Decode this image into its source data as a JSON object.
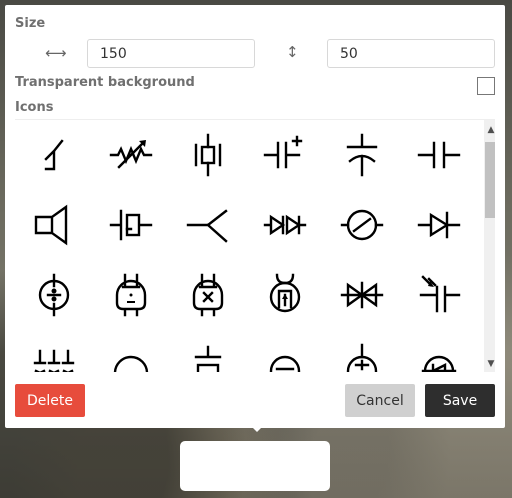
{
  "size": {
    "label": "Size",
    "width_icon": "horizontal-resize-icon",
    "width_value": "150",
    "height_icon": "vertical-resize-icon",
    "height_value": "50"
  },
  "transparent": {
    "label": "Transparent background",
    "checked": false
  },
  "icons": {
    "label": "Icons",
    "items": [
      "thermal-switch-icon",
      "variable-resistor-icon",
      "crystal-oscillator-icon",
      "polarized-capacitor-icon",
      "variable-capacitor-icon",
      "capacitor-icon",
      "loudspeaker-icon",
      "piezo-crystal-icon",
      "antenna-switch-icon",
      "bidirectional-diode-icon",
      "lamp-icon",
      "diode-icon",
      "vacuum-tube-triode-icon",
      "vacuum-tube-heated-icon",
      "vacuum-tube-cross-icon",
      "phototube-icon",
      "diac-icon",
      "photo-capacitor-icon",
      "multi-ground-icon",
      "arc-icon",
      "plate-capacitor-icon",
      "minus-circle-icon",
      "plus-circle-icon",
      "led-diode-circle-icon"
    ]
  },
  "buttons": {
    "delete": "Delete",
    "cancel": "Cancel",
    "save": "Save"
  },
  "colors": {
    "delete": "#e74c3c",
    "cancel": "#d0d0d0",
    "save": "#2e2e2e"
  }
}
